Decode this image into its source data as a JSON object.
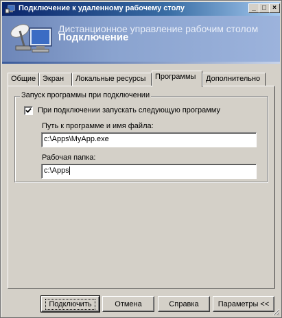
{
  "window": {
    "title": "Подключение к удаленному рабочему столу",
    "controls": {
      "minimize": "_",
      "maximize": "□",
      "close": "×"
    }
  },
  "banner": {
    "line1": "Дистанционное управление рабочим столом",
    "line2": "Подключение"
  },
  "tabs": [
    {
      "label": "Общие"
    },
    {
      "label": "Экран"
    },
    {
      "label": "Локальные ресурсы"
    },
    {
      "label": "Программы",
      "active": true
    },
    {
      "label": "Дополнительно"
    }
  ],
  "programs": {
    "group_title": "Запуск программы при подключении",
    "start_program_checkbox": {
      "label": "При подключении запускать следующую программу",
      "checked": true
    },
    "path_label": "Путь к программе и имя файла:",
    "path_value": "c:\\Apps\\MyApp.exe",
    "folder_label": "Рабочая папка:",
    "folder_value": "c:\\Apps"
  },
  "buttons": {
    "connect": "Подключить",
    "cancel": "Отмена",
    "help": "Справка",
    "options": "Параметры <<"
  },
  "icons": {
    "title": "remote-desktop-icon",
    "logo": "remote-desktop-logo-icon"
  },
  "colors": {
    "titlebar_start": "#0a246a",
    "titlebar_end": "#a6caf0",
    "banner": "#8aa3cf",
    "face": "#d4d0c8"
  }
}
